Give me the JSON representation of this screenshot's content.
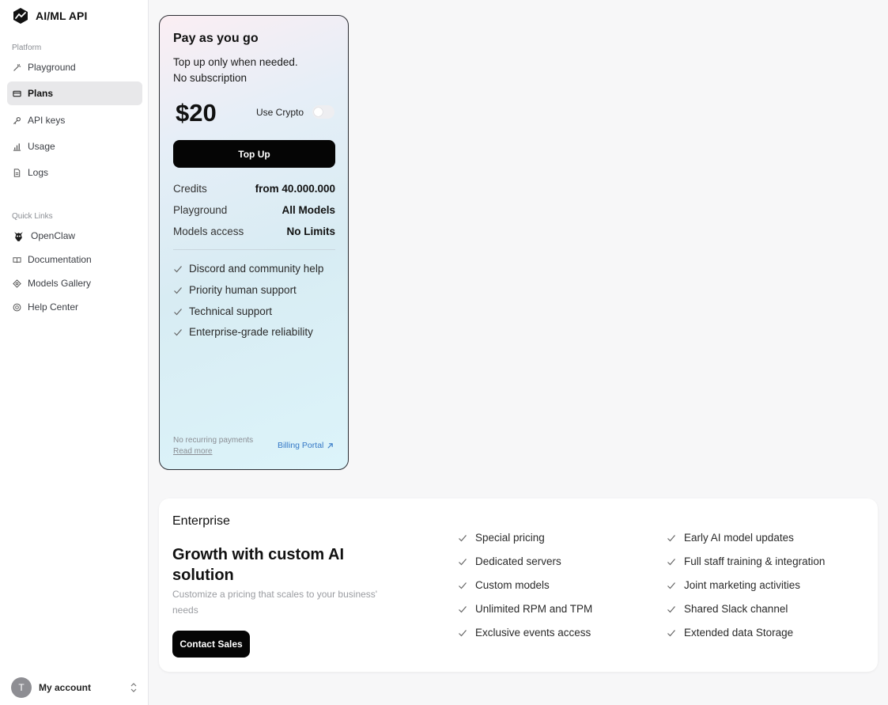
{
  "brand": {
    "name": "AI/ML API",
    "logo_icon": "pulse-hexagon-icon"
  },
  "sidebar": {
    "platform_label": "Platform",
    "platform_items": [
      {
        "label": "Playground",
        "icon": "magic-wand-icon"
      },
      {
        "label": "Plans",
        "icon": "card-icon",
        "active": true
      },
      {
        "label": "API keys",
        "icon": "key-icon"
      },
      {
        "label": "Usage",
        "icon": "bar-chart-icon"
      },
      {
        "label": "Logs",
        "icon": "document-icon"
      }
    ],
    "quicklinks_label": "Quick Links",
    "quick_links": [
      {
        "label": "OpenClaw",
        "icon": "claw-icon"
      },
      {
        "label": "Documentation",
        "icon": "book-icon"
      },
      {
        "label": "Models Gallery",
        "icon": "gallery-icon"
      },
      {
        "label": "Help Center",
        "icon": "help-icon"
      }
    ],
    "account": {
      "initial": "T",
      "label": "My account"
    }
  },
  "payg": {
    "title": "Pay as you go",
    "desc_line1": "Top up only when needed.",
    "desc_line2": "No subscription",
    "price": "$20",
    "crypto_label": "Use Crypto",
    "crypto_enabled": false,
    "topup_label": "Top Up",
    "details": [
      {
        "key": "Credits",
        "value": "from 40.000.000"
      },
      {
        "key": "Playground",
        "value": "All Models"
      },
      {
        "key": "Models access",
        "value": "No Limits"
      }
    ],
    "features": [
      "Discord and community help",
      "Priority human support",
      "Technical support",
      "Enterprise-grade reliability"
    ],
    "footnote": "No recurring payments",
    "read_more": "Read more",
    "billing_portal": "Billing Portal"
  },
  "enterprise": {
    "label": "Enterprise",
    "heading": "Growth with custom AI solution",
    "description": "Customize a pricing that scales to your business' needs",
    "contact_label": "Contact Sales",
    "features_col1": [
      "Special pricing",
      "Dedicated servers",
      "Custom models",
      "Unlimited RPM and TPM",
      "Exclusive events access"
    ],
    "features_col2": [
      "Early AI model updates",
      "Full staff training & integration",
      "Joint marketing activities",
      "Shared Slack channel",
      "Extended data Storage"
    ]
  },
  "colors": {
    "accent_link": "#3478c6",
    "button_bg": "#050505",
    "card_border": "#2b2d33"
  }
}
